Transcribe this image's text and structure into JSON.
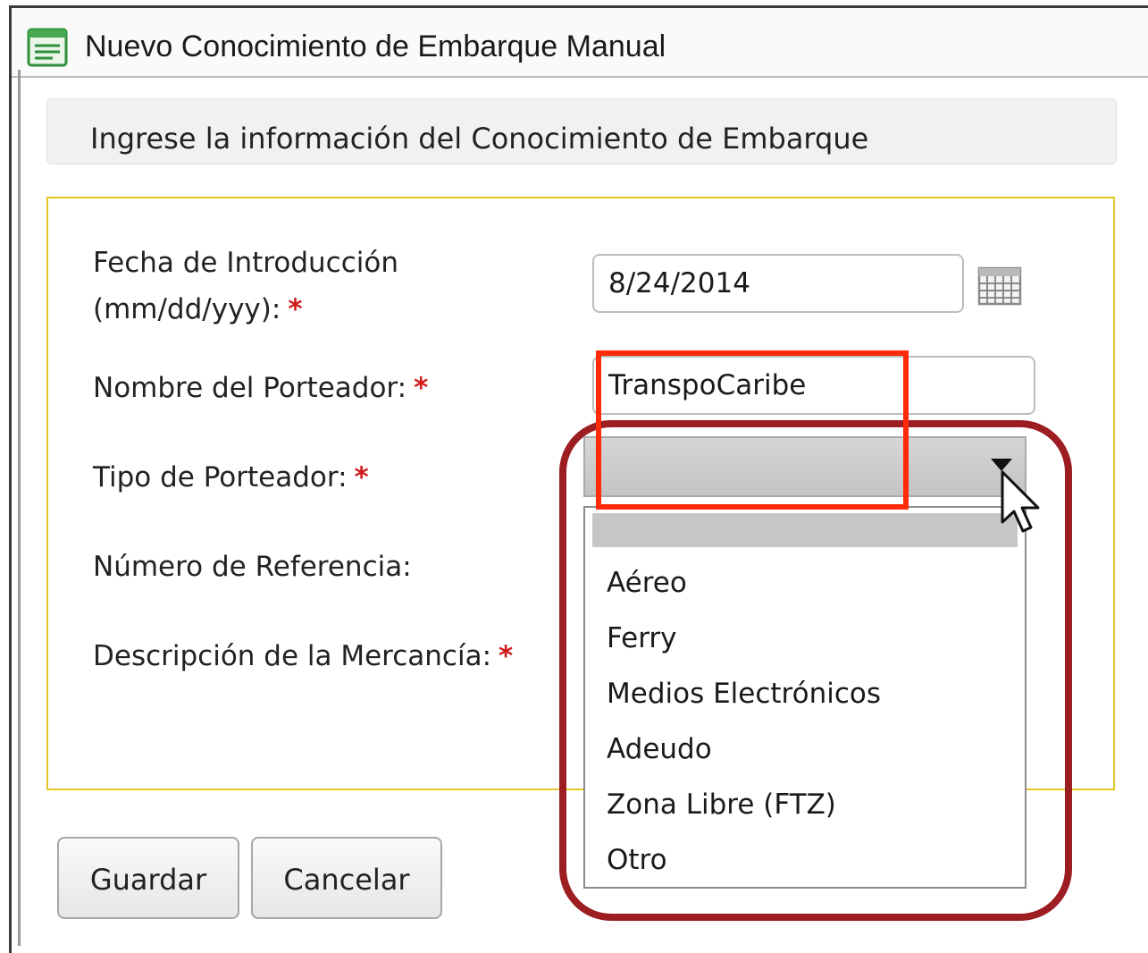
{
  "window": {
    "title": "Nuevo Conocimiento de Embarque Manual",
    "icon": "form-window-icon"
  },
  "banner": {
    "text": "Ingrese la información del Conocimiento de Embarque"
  },
  "form": {
    "required_marker": "*",
    "fecha": {
      "label_line1": "Fecha de Introducción",
      "label_line2": "(mm/dd/yyy):",
      "value": "8/24/2014",
      "icon": "calendar-icon"
    },
    "nombre_porteador": {
      "label": "Nombre del Porteador:",
      "value": "TranspoCaribe"
    },
    "tipo_porteador": {
      "label": "Tipo de Porteador:",
      "selected": "",
      "options": [
        "",
        "Aéreo",
        "Ferry",
        "Medios Electrónicos",
        "Adeudo",
        "Zona Libre (FTZ)",
        "Otro"
      ]
    },
    "numero_referencia": {
      "label": "Número de Referencia:"
    },
    "descripcion_mercancia": {
      "label": "Descripción de la Mercancía:"
    }
  },
  "buttons": {
    "save": "Guardar",
    "cancel": "Cancelar"
  },
  "colors": {
    "required": "#d11a1a",
    "form_border": "#e4c72a",
    "highlight_red": "#ff2a0a",
    "highlight_maroon": "#9c1d22"
  }
}
